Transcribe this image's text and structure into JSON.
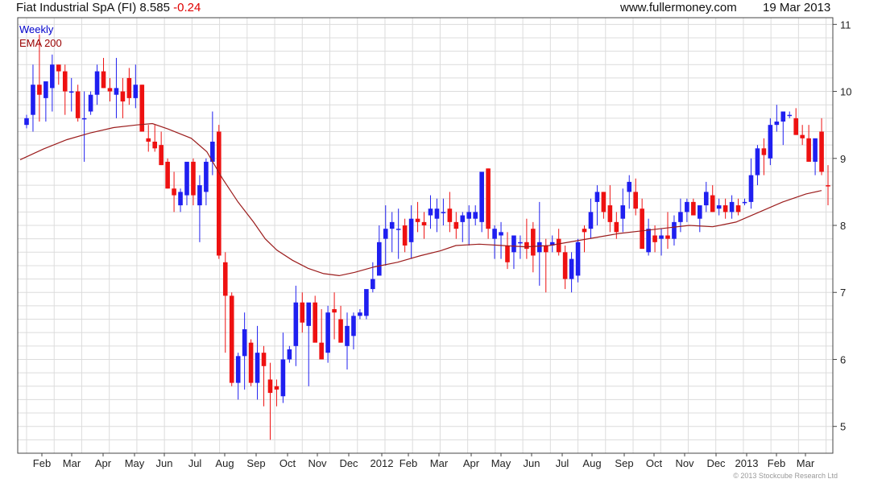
{
  "header": {
    "name": "Fiat Industrial SpA (FI)",
    "price": "8.585",
    "change": "-0.24",
    "site": "www.fullermoney.com",
    "date": "19 Mar 2013"
  },
  "legend": {
    "series1": "Weekly",
    "series2": "EMA 200"
  },
  "copyright": "© 2013 Stockcube Research Ltd",
  "colors": {
    "up": "#1f1ff0",
    "down": "#ee1111",
    "ema": "#9b1c1c",
    "grid": "#dcdcdc"
  },
  "chart_data": {
    "type": "candlestick",
    "ylim": [
      4.6,
      11.1
    ],
    "yticks": [
      5,
      6,
      7,
      8,
      9,
      10,
      11
    ],
    "grid": true,
    "y_axis_position": "right",
    "x_tick_labels": [
      "Feb",
      "Mar",
      "Apr",
      "May",
      "Jun",
      "Jul",
      "Aug",
      "Sep",
      "Oct",
      "Nov",
      "Dec",
      "2012",
      "Feb",
      "Mar",
      "Apr",
      "May",
      "Jun",
      "Jul",
      "Aug",
      "Sep",
      "Oct",
      "Nov",
      "Dec",
      "2013",
      "Feb",
      "Mar"
    ],
    "series": [
      {
        "name": "Weekly",
        "ohlc": [
          [
            9.5,
            9.65,
            9.45,
            9.6
          ],
          [
            9.65,
            10.4,
            9.4,
            10.1
          ],
          [
            10.1,
            10.85,
            9.55,
            9.95
          ],
          [
            9.9,
            10.1,
            9.55,
            10.15
          ],
          [
            10.05,
            10.55,
            9.7,
            10.4
          ],
          [
            10.4,
            10.4,
            10.1,
            10.3
          ],
          [
            10.3,
            10.4,
            9.65,
            10.0
          ],
          [
            10.0,
            10.2,
            9.7,
            10.0
          ],
          [
            10.0,
            10.1,
            9.55,
            9.6
          ],
          [
            9.6,
            10.0,
            8.95,
            9.6
          ],
          [
            9.7,
            10.0,
            9.65,
            9.95
          ],
          [
            9.95,
            10.4,
            9.8,
            10.3
          ],
          [
            10.3,
            10.5,
            10.05,
            10.05
          ],
          [
            10.05,
            10.2,
            9.85,
            10.0
          ],
          [
            9.95,
            10.5,
            9.6,
            10.05
          ],
          [
            10.0,
            10.2,
            9.6,
            9.85
          ],
          [
            10.2,
            10.35,
            9.8,
            9.9
          ],
          [
            9.9,
            10.4,
            9.75,
            10.1
          ],
          [
            10.1,
            10.1,
            9.4,
            9.4
          ],
          [
            9.3,
            9.5,
            9.1,
            9.25
          ],
          [
            9.25,
            9.5,
            9.1,
            9.15
          ],
          [
            9.2,
            9.4,
            8.9,
            8.9
          ],
          [
            8.95,
            9.0,
            8.55,
            8.55
          ],
          [
            8.55,
            8.8,
            8.2,
            8.45
          ],
          [
            8.3,
            8.55,
            8.2,
            8.5
          ],
          [
            8.45,
            8.95,
            8.3,
            8.95
          ],
          [
            8.95,
            9.0,
            8.3,
            8.45
          ],
          [
            8.3,
            8.75,
            7.75,
            8.6
          ],
          [
            8.5,
            9.0,
            8.3,
            8.95
          ],
          [
            8.95,
            9.7,
            8.75,
            9.25
          ],
          [
            9.4,
            9.5,
            7.5,
            7.55
          ],
          [
            7.45,
            7.6,
            6.1,
            6.95
          ],
          [
            6.95,
            7.0,
            5.6,
            5.65
          ],
          [
            5.65,
            6.1,
            5.4,
            6.05
          ],
          [
            6.05,
            6.7,
            5.55,
            6.45
          ],
          [
            6.25,
            6.3,
            5.6,
            5.65
          ],
          [
            5.65,
            6.5,
            5.4,
            6.1
          ],
          [
            6.1,
            6.2,
            5.3,
            5.9
          ],
          [
            5.7,
            5.95,
            4.8,
            5.5
          ],
          [
            5.6,
            5.7,
            5.3,
            5.55
          ],
          [
            5.45,
            6.4,
            5.35,
            6.0
          ],
          [
            6.0,
            6.2,
            5.95,
            6.15
          ],
          [
            6.2,
            7.1,
            5.9,
            6.85
          ],
          [
            6.85,
            7.0,
            6.4,
            6.55
          ],
          [
            6.5,
            6.7,
            5.6,
            6.85
          ],
          [
            6.85,
            6.95,
            6.6,
            6.25
          ],
          [
            6.25,
            6.75,
            6.0,
            6.0
          ],
          [
            6.1,
            6.8,
            5.95,
            6.7
          ],
          [
            6.75,
            7.0,
            6.3,
            6.7
          ],
          [
            6.6,
            6.8,
            6.25,
            6.25
          ],
          [
            6.2,
            6.7,
            5.85,
            6.5
          ],
          [
            6.35,
            6.7,
            6.15,
            6.65
          ],
          [
            6.65,
            6.75,
            6.6,
            6.7
          ],
          [
            6.65,
            7.0,
            6.6,
            7.05
          ],
          [
            7.05,
            7.45,
            7.0,
            7.2
          ],
          [
            7.25,
            8.0,
            7.3,
            7.75
          ],
          [
            7.8,
            8.3,
            7.4,
            7.95
          ],
          [
            7.95,
            8.2,
            7.6,
            8.05
          ],
          [
            7.95,
            8.25,
            7.5,
            7.95
          ],
          [
            8.0,
            8.1,
            7.6,
            7.7
          ],
          [
            7.75,
            8.3,
            7.5,
            8.1
          ],
          [
            8.1,
            8.35,
            7.9,
            8.05
          ],
          [
            8.05,
            8.2,
            7.8,
            8.0
          ],
          [
            8.15,
            8.45,
            7.95,
            8.25
          ],
          [
            8.1,
            8.4,
            7.9,
            8.25
          ],
          [
            8.2,
            8.4,
            8.0,
            8.2
          ],
          [
            8.25,
            8.5,
            7.9,
            8.05
          ],
          [
            8.05,
            8.2,
            7.8,
            7.95
          ],
          [
            8.05,
            8.2,
            7.75,
            8.15
          ],
          [
            8.1,
            8.3,
            7.7,
            8.2
          ],
          [
            8.1,
            8.3,
            8.0,
            8.2
          ],
          [
            8.05,
            8.75,
            7.9,
            8.8
          ],
          [
            8.85,
            8.85,
            7.8,
            7.95
          ],
          [
            7.8,
            8.0,
            7.5,
            7.95
          ],
          [
            7.85,
            8.05,
            7.5,
            7.9
          ],
          [
            7.7,
            7.9,
            7.35,
            7.45
          ],
          [
            7.6,
            7.8,
            7.35,
            7.85
          ],
          [
            7.75,
            7.85,
            7.5,
            7.75
          ],
          [
            7.75,
            8.1,
            7.5,
            7.65
          ],
          [
            7.95,
            8.05,
            7.3,
            7.55
          ],
          [
            7.6,
            8.35,
            7.1,
            7.75
          ],
          [
            7.7,
            7.8,
            7.0,
            7.6
          ],
          [
            7.7,
            7.85,
            7.6,
            7.75
          ],
          [
            7.8,
            7.95,
            7.55,
            7.6
          ],
          [
            7.6,
            7.7,
            7.05,
            7.2
          ],
          [
            7.2,
            7.6,
            7.0,
            7.5
          ],
          [
            7.25,
            7.8,
            7.15,
            7.75
          ],
          [
            7.95,
            8.0,
            7.6,
            7.9
          ],
          [
            7.95,
            8.4,
            7.8,
            8.2
          ],
          [
            8.35,
            8.6,
            8.0,
            8.5
          ],
          [
            8.5,
            8.5,
            8.1,
            8.2
          ],
          [
            8.3,
            8.6,
            7.9,
            8.05
          ],
          [
            8.05,
            8.2,
            7.8,
            7.9
          ],
          [
            8.1,
            8.55,
            7.9,
            8.3
          ],
          [
            8.5,
            8.75,
            8.25,
            8.65
          ],
          [
            8.5,
            8.7,
            8.15,
            8.25
          ],
          [
            8.25,
            8.4,
            7.8,
            7.65
          ],
          [
            7.6,
            8.1,
            7.55,
            7.95
          ],
          [
            7.85,
            8.0,
            7.6,
            7.75
          ],
          [
            7.8,
            7.95,
            7.55,
            7.85
          ],
          [
            7.85,
            8.2,
            7.65,
            7.8
          ],
          [
            7.8,
            8.15,
            7.7,
            8.05
          ],
          [
            8.05,
            8.4,
            7.9,
            8.2
          ],
          [
            8.2,
            8.4,
            8.05,
            8.35
          ],
          [
            8.35,
            8.4,
            8.15,
            8.15
          ],
          [
            8.1,
            8.3,
            7.9,
            8.3
          ],
          [
            8.3,
            8.65,
            8.2,
            8.5
          ],
          [
            8.45,
            8.6,
            8.2,
            8.2
          ],
          [
            8.25,
            8.4,
            8.15,
            8.3
          ],
          [
            8.3,
            8.4,
            8.1,
            8.2
          ],
          [
            8.2,
            8.45,
            8.1,
            8.35
          ],
          [
            8.3,
            8.4,
            8.15,
            8.2
          ],
          [
            8.35,
            8.4,
            8.3,
            8.35
          ],
          [
            8.35,
            9.0,
            8.25,
            8.75
          ],
          [
            8.75,
            9.2,
            8.6,
            9.15
          ],
          [
            9.15,
            9.3,
            8.75,
            9.05
          ],
          [
            9.0,
            9.6,
            8.9,
            9.5
          ],
          [
            9.5,
            9.8,
            9.4,
            9.55
          ],
          [
            9.55,
            9.7,
            9.2,
            9.7
          ],
          [
            9.65,
            9.7,
            9.6,
            9.65
          ],
          [
            9.6,
            9.75,
            9.35,
            9.35
          ],
          [
            9.35,
            9.5,
            9.2,
            9.3
          ],
          [
            9.3,
            9.5,
            8.95,
            8.95
          ],
          [
            8.95,
            9.2,
            8.75,
            9.3
          ],
          [
            9.4,
            9.6,
            8.75,
            8.8
          ],
          [
            8.6,
            8.9,
            8.3,
            8.585
          ]
        ]
      },
      {
        "name": "EMA 200",
        "values": [
          [
            0,
            8.98
          ],
          [
            6,
            9.14
          ],
          [
            12,
            9.28
          ],
          [
            18,
            9.38
          ],
          [
            24,
            9.46
          ],
          [
            30,
            9.5
          ],
          [
            34,
            9.52
          ],
          [
            38,
            9.44
          ],
          [
            44,
            9.3
          ],
          [
            48,
            9.1
          ],
          [
            52,
            8.7
          ],
          [
            56,
            8.35
          ],
          [
            60,
            8.05
          ],
          [
            63,
            7.8
          ],
          [
            66,
            7.63
          ],
          [
            70,
            7.48
          ],
          [
            74,
            7.36
          ],
          [
            78,
            7.28
          ],
          [
            82,
            7.25
          ],
          [
            86,
            7.3
          ],
          [
            91,
            7.38
          ],
          [
            97,
            7.45
          ],
          [
            103,
            7.55
          ],
          [
            108,
            7.62
          ],
          [
            112,
            7.7
          ],
          [
            118,
            7.72
          ],
          [
            124,
            7.7
          ],
          [
            130,
            7.68
          ],
          [
            136,
            7.7
          ],
          [
            142,
            7.76
          ],
          [
            148,
            7.82
          ],
          [
            154,
            7.88
          ],
          [
            160,
            7.92
          ],
          [
            166,
            7.96
          ],
          [
            172,
            8.0
          ],
          [
            178,
            7.98
          ],
          [
            184,
            8.05
          ],
          [
            190,
            8.2
          ],
          [
            196,
            8.35
          ],
          [
            202,
            8.47
          ],
          [
            206,
            8.52
          ]
        ]
      }
    ]
  }
}
